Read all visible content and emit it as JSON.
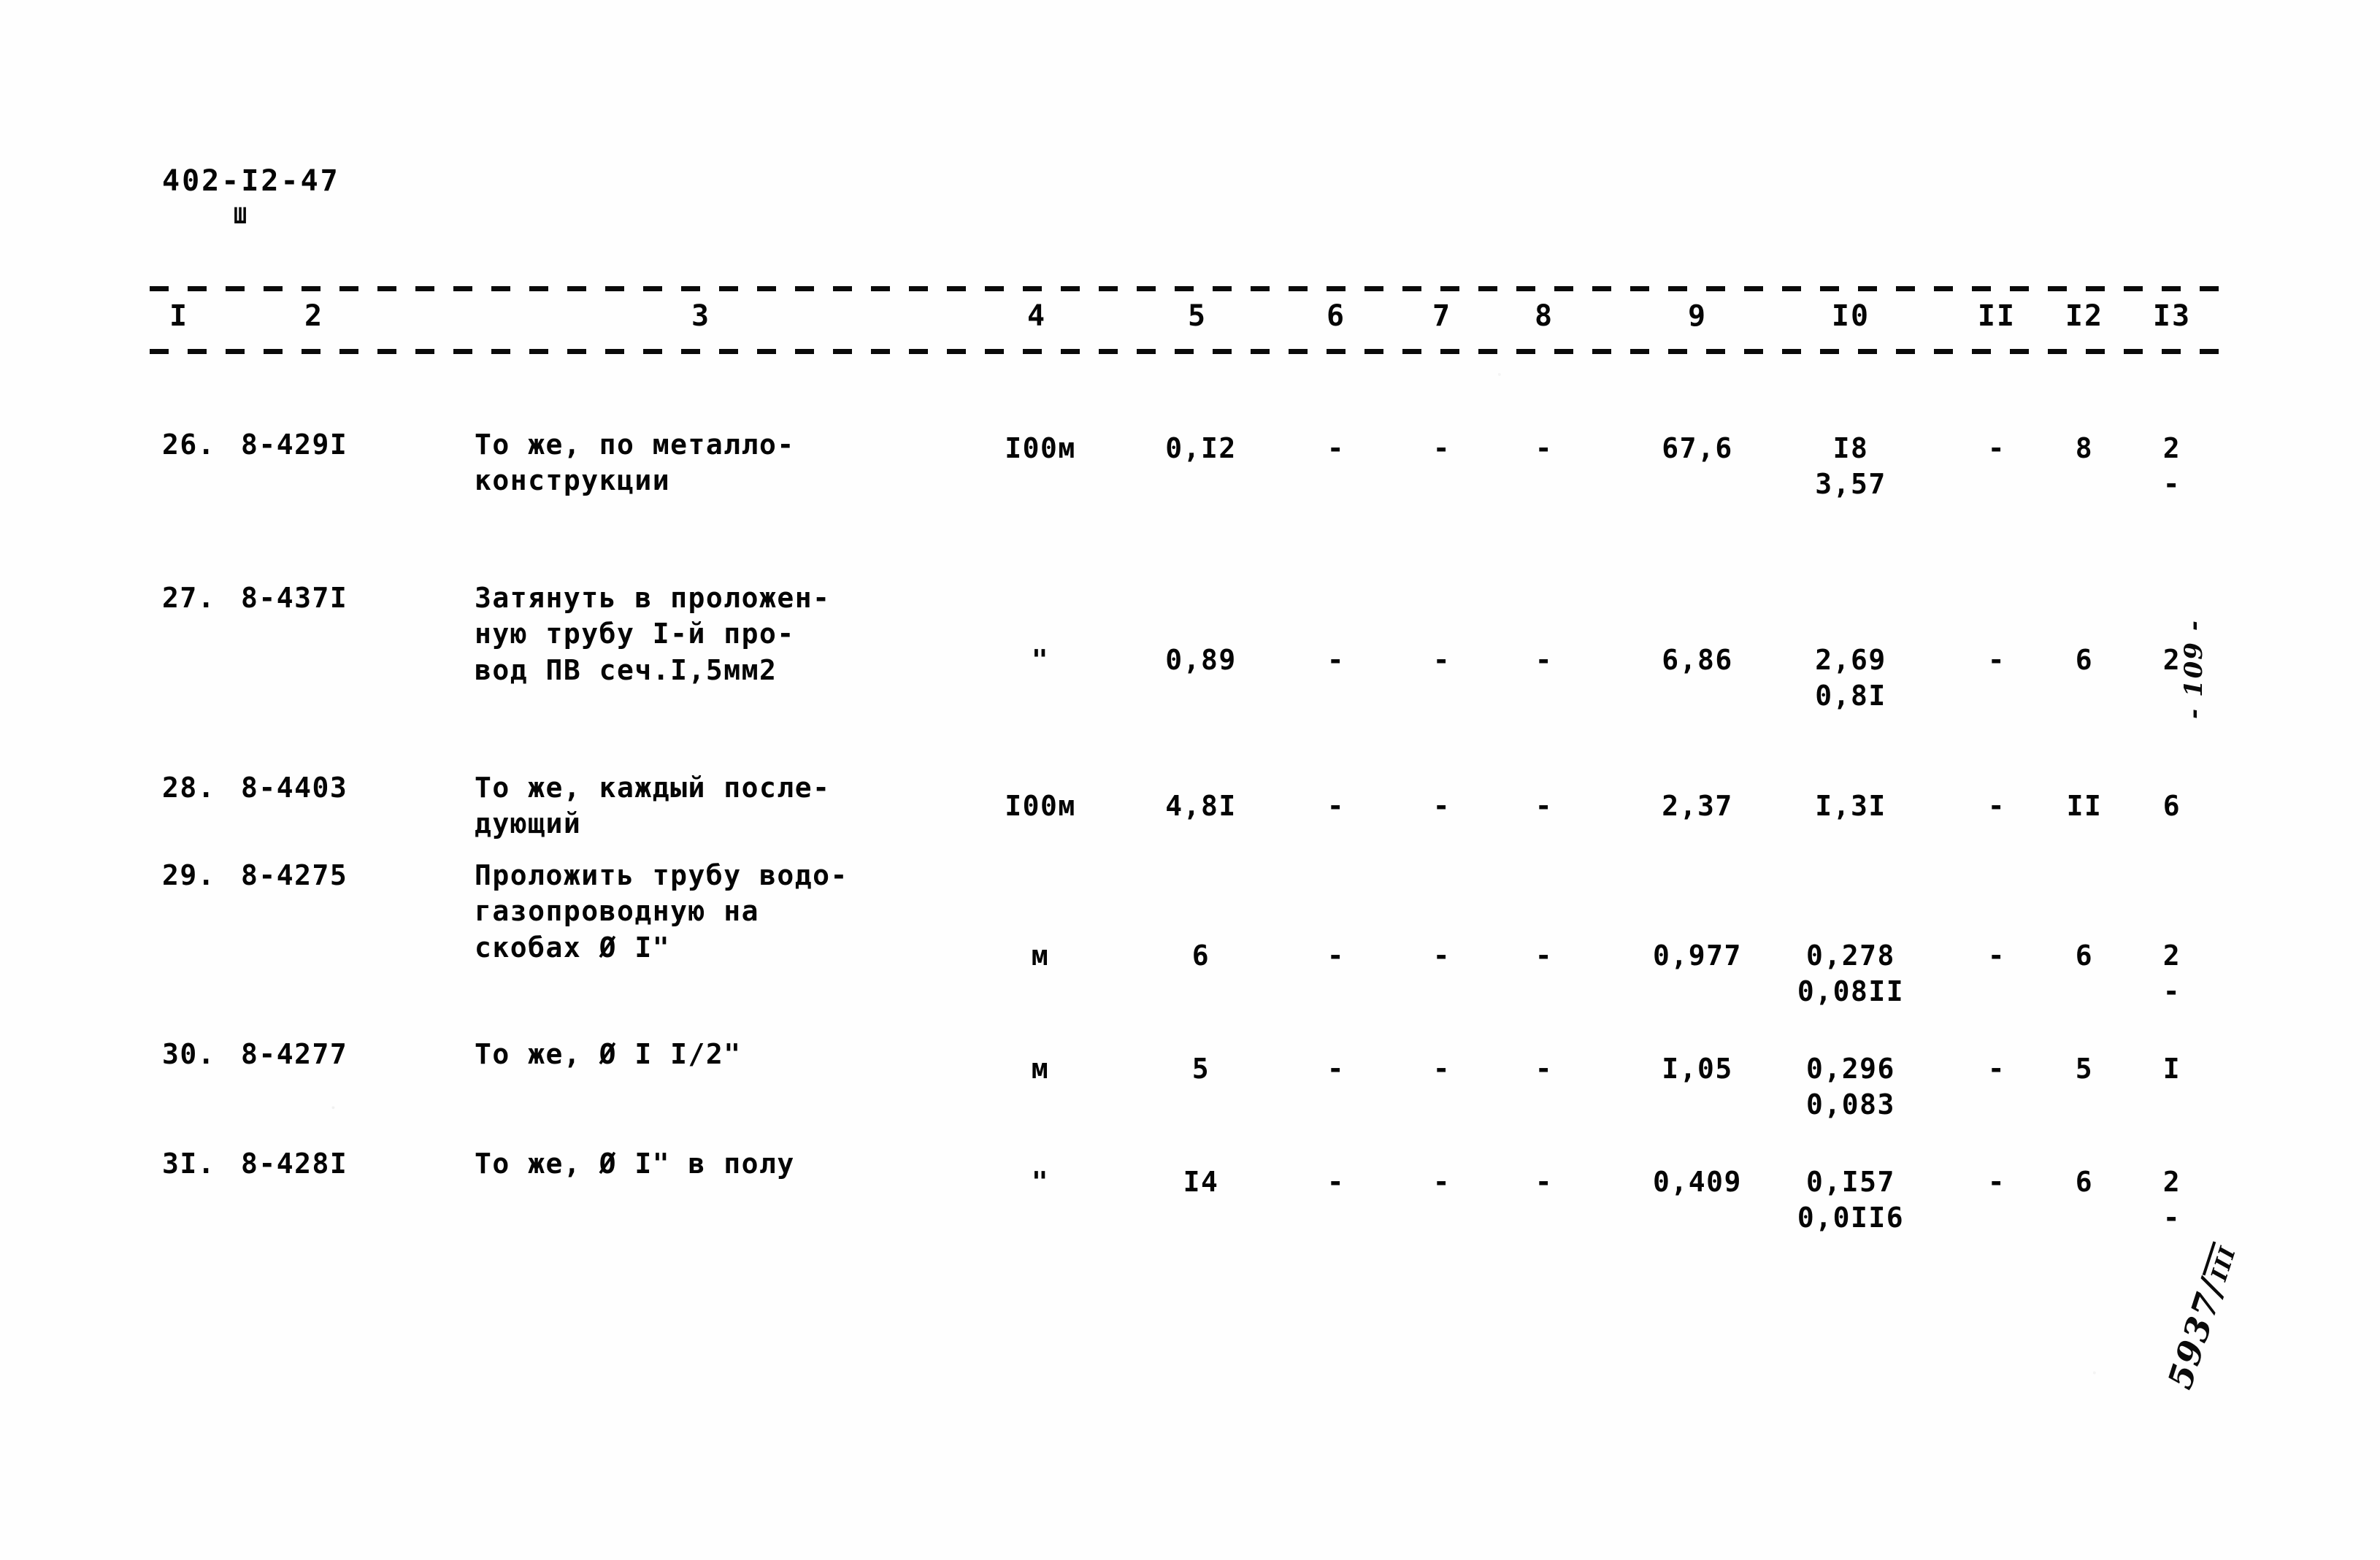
{
  "document": {
    "code": "402-I2-47",
    "code_sub": "Ш",
    "page_number_margin": "- 109 -",
    "archive_stamp_numerator": "5937/",
    "archive_stamp_denominator": "III"
  },
  "table": {
    "column_numbers": [
      "I",
      "2",
      "3",
      "4",
      "5",
      "6",
      "7",
      "8",
      "9",
      "I0",
      "II",
      "I2",
      "I3"
    ],
    "rows": [
      {
        "num": "26.",
        "code": "8-429I",
        "desc": "То же, по металло-\nконструкции",
        "unit": "I00м",
        "c5": "0,I2",
        "c6": "-",
        "c7": "-",
        "c8": "-",
        "c9": "67,6",
        "c10": "I8",
        "c10_sub": "3,57",
        "c11": "-",
        "c12": "8",
        "c13": "2",
        "c13_sub": "-"
      },
      {
        "num": "27.",
        "code": "8-437I",
        "desc": "Затянуть в проложен-\nную трубу I-й про-\nвод ПВ сеч.I,5мм2",
        "unit": "\"",
        "c5": "0,89",
        "c6": "-",
        "c7": "-",
        "c8": "-",
        "c9": "6,86",
        "c10": "2,69",
        "c10_sub": "0,8I",
        "c11": "-",
        "c12": "6",
        "c13": "2",
        "c13_sub": ""
      },
      {
        "num": "28.",
        "code": "8-4403",
        "desc": "То же, каждый после-\nдующий",
        "unit": "I00м",
        "c5": "4,8I",
        "c6": "-",
        "c7": "-",
        "c8": "-",
        "c9": "2,37",
        "c10": "I,3I",
        "c10_sub": "",
        "c11": "-",
        "c12": "II",
        "c13": "6",
        "c13_sub": ""
      },
      {
        "num": "29.",
        "code": "8-4275",
        "desc": "Проложить трубу водо-\nгазопроводную на\nскобах Ø I\"",
        "unit": "м",
        "c5": "6",
        "c6": "-",
        "c7": "-",
        "c8": "-",
        "c9": "0,977",
        "c10": "0,278",
        "c10_sub": "0,08II",
        "c11": "-",
        "c12": "6",
        "c13": "2",
        "c13_sub": "-"
      },
      {
        "num": "30.",
        "code": "8-4277",
        "desc": "То же, Ø I I/2\"",
        "unit": "м",
        "c5": "5",
        "c6": "-",
        "c7": "-",
        "c8": "-",
        "c9": "I,05",
        "c10": "0,296",
        "c10_sub": "0,083",
        "c11": "-",
        "c12": "5",
        "c13": "I",
        "c13_sub": ""
      },
      {
        "num": "3I.",
        "code": "8-428I",
        "desc": "То же, Ø I\" в полу",
        "unit": "\"",
        "c5": "I4",
        "c6": "-",
        "c7": "-",
        "c8": "-",
        "c9": "0,409",
        "c10": "0,I57",
        "c10_sub": "0,0II6",
        "c11": "-",
        "c12": "6",
        "c13": "2",
        "c13_sub": "-"
      }
    ]
  },
  "layout": {
    "column_x": [
      245,
      430,
      960,
      1420,
      1640,
      1830,
      1975,
      2115,
      2325,
      2535,
      2735,
      2855,
      2975
    ],
    "row_top": [
      585,
      795,
      1055,
      1175,
      1420,
      1570
    ],
    "row_value_top": [
      590,
      880,
      1080,
      1285,
      1440,
      1595
    ]
  }
}
